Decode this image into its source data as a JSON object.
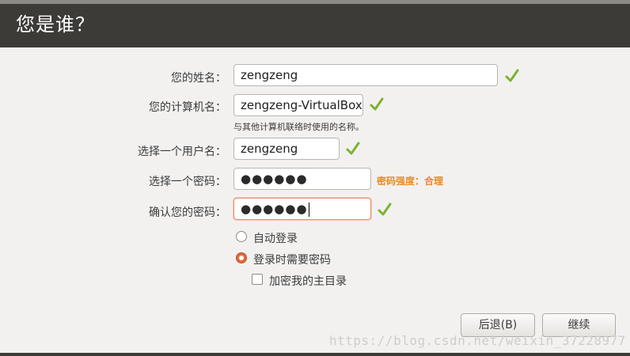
{
  "header": {
    "title": "您是谁？"
  },
  "form": {
    "name_label": "您的姓名：",
    "name_value": "zengzeng",
    "computer_label": "您的计算机名：",
    "computer_value": "zengzeng-VirtualBox",
    "computer_hint": "与其他计算机联络时使用的名称。",
    "username_label": "选择一个用户名：",
    "username_value": "zengzeng",
    "password_label": "选择一个密码：",
    "password_value": "●●●●●●",
    "password_strength": "密码强度：合理",
    "confirm_label": "确认您的密码：",
    "confirm_value": "●●●●●●"
  },
  "options": {
    "auto_login": "自动登录",
    "require_password": "登录时需要密码",
    "encrypt_home": "加密我的主目录",
    "selected": "require_password",
    "encrypt_checked": false
  },
  "buttons": {
    "back": "后退(B)",
    "continue": "继续"
  },
  "watermark": "https://blog.csdn.net/weixin_37228977",
  "colors": {
    "header_bg": "#3c3b37",
    "accent": "#e26a3b",
    "check": "#7bb32e",
    "strength": "#e88a1e"
  },
  "icons": {
    "valid": "green-check-icon"
  }
}
